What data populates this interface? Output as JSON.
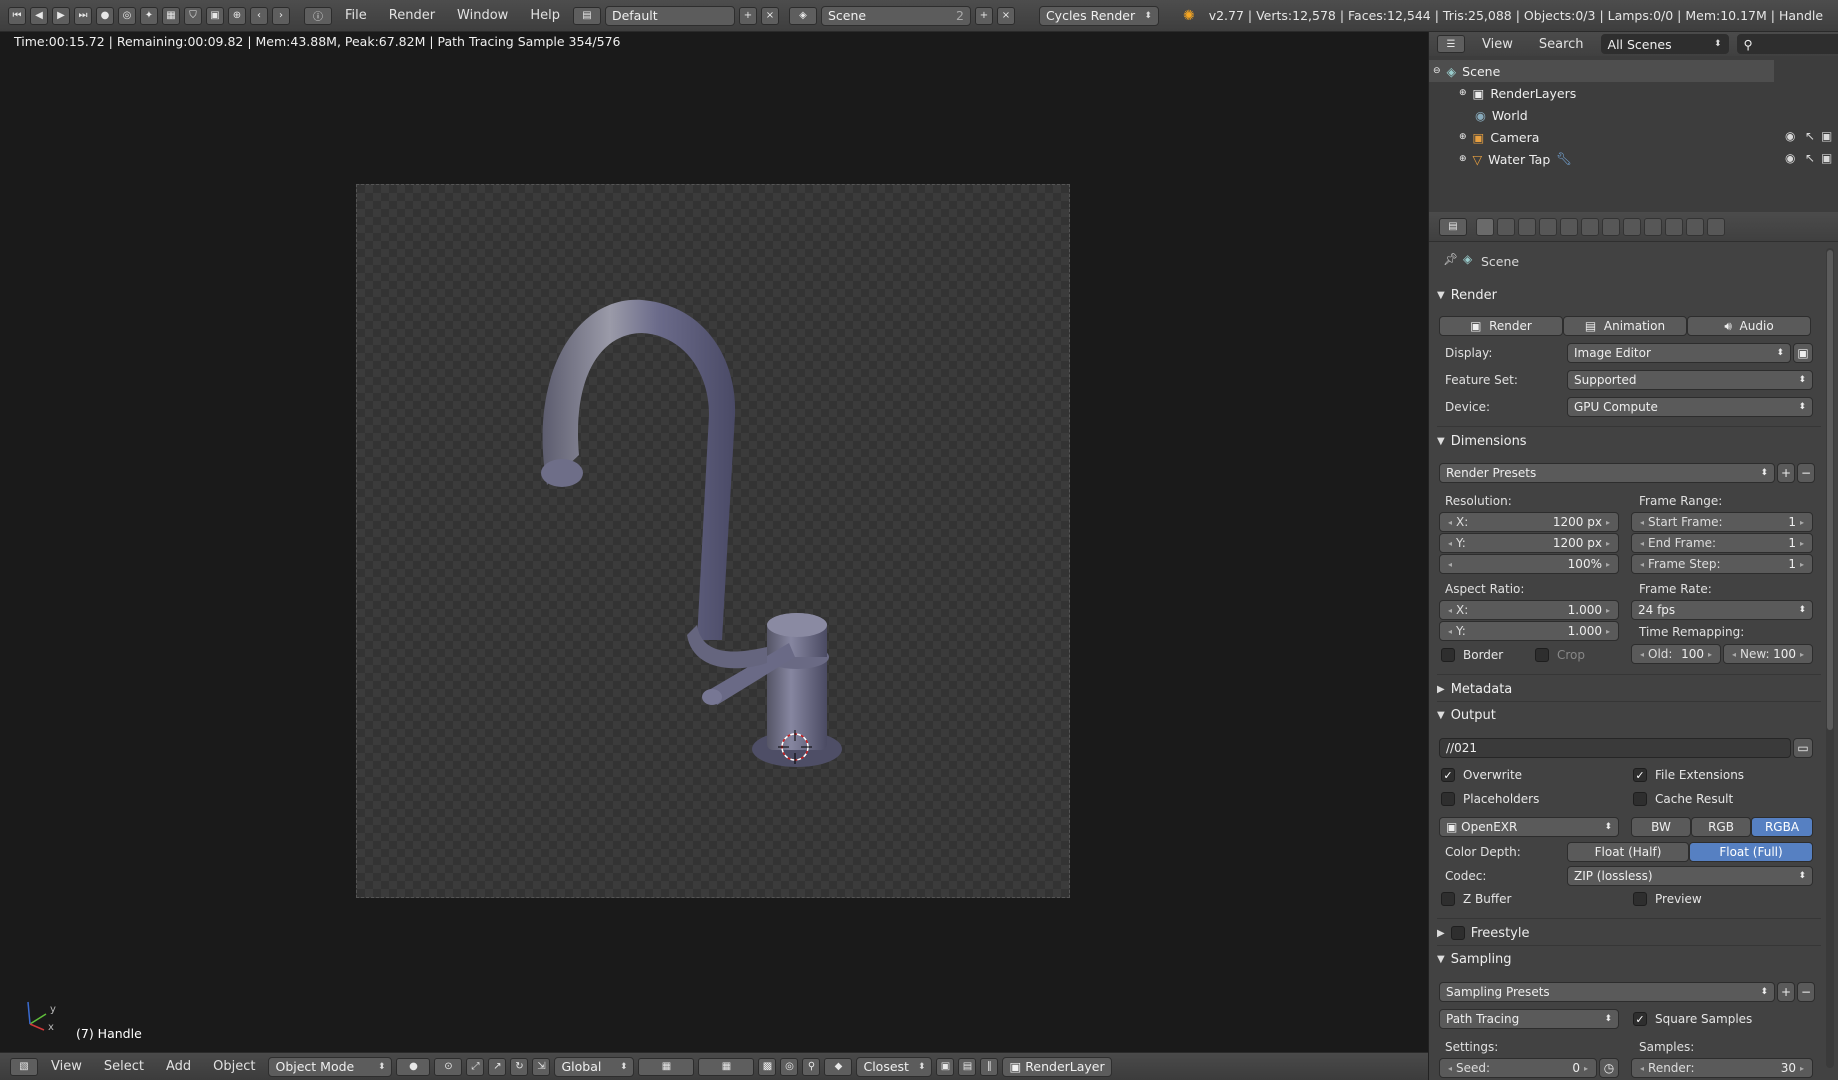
{
  "topbar": {
    "menus": [
      "File",
      "Render",
      "Window",
      "Help"
    ],
    "layout": "Default",
    "scene": "Scene",
    "scene_count": "2",
    "engine": "Cycles Render",
    "stats": "v2.77 | Verts:12,578 | Faces:12,544 | Tris:25,088 | Objects:0/3 | Lamps:0/0 | Mem:10.17M | Handle"
  },
  "viewport": {
    "render_info": "Time:00:15.72 | Remaining:00:09.82 | Mem:43.88M, Peak:67.82M | Path Tracing Sample 354/576",
    "object_label": "(7) Handle",
    "axis_y": "y",
    "axis_x": "x"
  },
  "bottombar": {
    "menus": [
      "View",
      "Select",
      "Add",
      "Object"
    ],
    "mode": "Object Mode",
    "orientation": "Global",
    "snap": "Closest",
    "render_layer": "RenderLayer"
  },
  "outliner": {
    "view": "View",
    "search": "Search",
    "filter": "All Scenes",
    "items": [
      "Scene",
      "RenderLayers",
      "World",
      "Camera",
      "Water Tap"
    ]
  },
  "props": {
    "context": "Scene",
    "sections": {
      "render": "Render",
      "dimensions": "Dimensions",
      "metadata": "Metadata",
      "output": "Output",
      "freestyle": "Freestyle",
      "sampling": "Sampling"
    },
    "render_buttons": [
      "Render",
      "Animation",
      "Audio"
    ],
    "display_label": "Display:",
    "display": "Image Editor",
    "feature_label": "Feature Set:",
    "feature": "Supported",
    "device_label": "Device:",
    "device": "GPU Compute",
    "render_presets": "Render Presets",
    "resolution_label": "Resolution:",
    "res_x_k": "X:",
    "res_x": "1200 px",
    "res_y_k": "Y:",
    "res_y": "1200 px",
    "res_pct": "100%",
    "frame_range_label": "Frame Range:",
    "start_k": "Start Frame:",
    "start": "1",
    "end_k": "End Frame:",
    "end": "1",
    "step_k": "Frame Step:",
    "step": "1",
    "aspect_label": "Aspect Ratio:",
    "asp_x_k": "X:",
    "asp_x": "1.000",
    "asp_y_k": "Y:",
    "asp_y": "1.000",
    "frame_rate_label": "Frame Rate:",
    "fps": "24 fps",
    "time_remap_label": "Time Remapping:",
    "old_k": "Old:",
    "old": "100",
    "new_k": "New:",
    "new": "100",
    "border": "Border",
    "crop": "Crop",
    "output_path": "//021",
    "overwrite": "Overwrite",
    "file_ext": "File Extensions",
    "placeholders": "Placeholders",
    "cache": "Cache Result",
    "format": "OpenEXR",
    "bw": "BW",
    "rgb": "RGB",
    "rgba": "RGBA",
    "color_depth_label": "Color Depth:",
    "half": "Float (Half)",
    "full": "Float (Full)",
    "codec_label": "Codec:",
    "codec": "ZIP (lossless)",
    "zbuffer": "Z Buffer",
    "preview": "Preview",
    "sampling_presets": "Sampling Presets",
    "integrator": "Path Tracing",
    "square_samples": "Square Samples",
    "settings_label": "Settings:",
    "samples_label": "Samples:",
    "seed_k": "Seed:",
    "seed": "0",
    "render_k": "Render:",
    "render_samples": "30"
  },
  "colors": {
    "accent": "#5680c2",
    "bg": "#1c1c1c"
  }
}
